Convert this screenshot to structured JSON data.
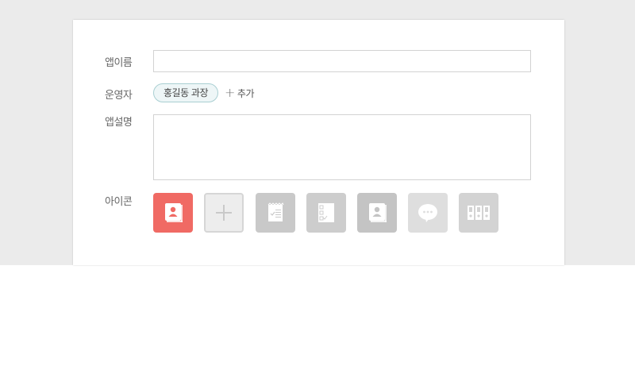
{
  "form": {
    "app_name": {
      "label": "앱이름",
      "value": ""
    },
    "operator": {
      "label": "운영자",
      "chip": "홍길동 과장",
      "add_label": "추가"
    },
    "description": {
      "label": "앱설명",
      "value": ""
    },
    "icon": {
      "label": "아이콘",
      "options": [
        {
          "name": "contact-book-icon",
          "color": "#f06a64",
          "selected": true
        },
        {
          "name": "add-icon",
          "color": "#ededed",
          "selected": false
        },
        {
          "name": "notepad-icon",
          "color": "#c9c9c9",
          "selected": false
        },
        {
          "name": "checklist-icon",
          "color": "#cdcdcd",
          "selected": false
        },
        {
          "name": "contact-book-icon",
          "color": "#c4c4c4",
          "selected": false
        },
        {
          "name": "chat-bubble-icon",
          "color": "#dedede",
          "selected": false
        },
        {
          "name": "binders-icon",
          "color": "#d3d3d3",
          "selected": false
        }
      ]
    }
  }
}
